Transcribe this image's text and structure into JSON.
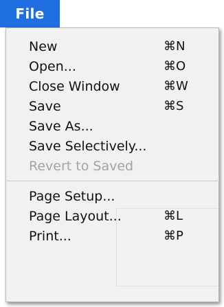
{
  "menu": {
    "title": "File",
    "items": [
      {
        "label": "New",
        "shortcut": "⌘N",
        "enabled": true
      },
      {
        "label": "Open...",
        "shortcut": "⌘O",
        "enabled": true
      },
      {
        "label": "Close Window",
        "shortcut": "⌘W",
        "enabled": true
      },
      {
        "label": "Save",
        "shortcut": "⌘S",
        "enabled": true
      },
      {
        "label": "Save As...",
        "shortcut": "",
        "enabled": true
      },
      {
        "label": "Save Selectively...",
        "shortcut": "",
        "enabled": true
      },
      {
        "label": "Revert to Saved",
        "shortcut": "",
        "enabled": false
      },
      {
        "label": "Page Setup...",
        "shortcut": "",
        "enabled": true
      },
      {
        "label": "Page Layout...",
        "shortcut": "⌘L",
        "enabled": true
      },
      {
        "label": "Print...",
        "shortcut": "⌘P",
        "enabled": true
      }
    ]
  },
  "colors": {
    "title_bg": "#1f6fe0",
    "menu_bg": "#f1f1f1",
    "disabled_text": "#a3a3a3"
  }
}
